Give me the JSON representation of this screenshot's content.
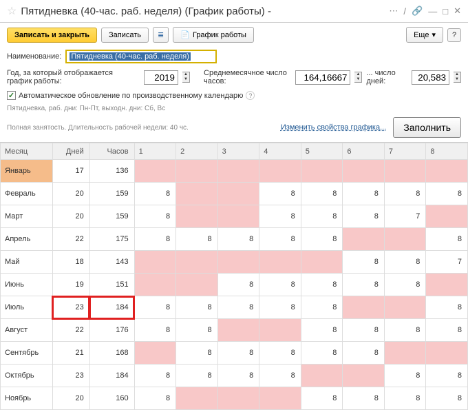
{
  "title": "Пятидневка (40-час. раб. неделя) (График работы) -",
  "toolbar": {
    "save_close": "Записать и закрыть",
    "save": "Записать",
    "schedule": "График работы",
    "more": "Еще"
  },
  "form": {
    "name_label": "Наименование:",
    "name_value": "Пятидневка (40-час. раб. неделя)",
    "year_label": "Год, за который отображается график работы:",
    "year_value": "2019",
    "avg_hours_label": "Среднемесячное число часов:",
    "avg_hours_value": "164,16667",
    "days_label": "... число дней:",
    "days_value": "20,583",
    "auto_update": "Автоматическое обновление по производственному календарю"
  },
  "hints": {
    "line1": "Пятидневка, раб. дни: Пн-Пт, выходн. дни: Сб, Вс",
    "line2": "Полная занятость. Длительность рабочей недели: 40 чс."
  },
  "actions": {
    "change_props": "Изменить свойства графика...",
    "fill": "Заполнить"
  },
  "headers": {
    "month": "Месяц",
    "days": "Дней",
    "hours": "Часов",
    "d1": "1",
    "d2": "2",
    "d3": "3",
    "d4": "4",
    "d5": "5",
    "d6": "6",
    "d7": "7",
    "d8": "8"
  },
  "rows": [
    {
      "month": "Январь",
      "days": 17,
      "hours": 136,
      "cells": [
        {
          "v": "",
          "c": "pink"
        },
        {
          "v": "",
          "c": "pink"
        },
        {
          "v": "",
          "c": "pink"
        },
        {
          "v": "",
          "c": "pink"
        },
        {
          "v": "",
          "c": "pink"
        },
        {
          "v": "",
          "c": "pink"
        },
        {
          "v": "",
          "c": "pink"
        },
        {
          "v": "",
          "c": "pink"
        }
      ],
      "mClass": "orange"
    },
    {
      "month": "Февраль",
      "days": 20,
      "hours": 159,
      "cells": [
        {
          "v": "8",
          "c": ""
        },
        {
          "v": "",
          "c": "pink"
        },
        {
          "v": "",
          "c": "pink"
        },
        {
          "v": "8",
          "c": ""
        },
        {
          "v": "8",
          "c": ""
        },
        {
          "v": "8",
          "c": ""
        },
        {
          "v": "8",
          "c": ""
        },
        {
          "v": "8",
          "c": ""
        }
      ]
    },
    {
      "month": "Март",
      "days": 20,
      "hours": 159,
      "cells": [
        {
          "v": "8",
          "c": ""
        },
        {
          "v": "",
          "c": "pink"
        },
        {
          "v": "",
          "c": "pink"
        },
        {
          "v": "8",
          "c": ""
        },
        {
          "v": "8",
          "c": ""
        },
        {
          "v": "8",
          "c": ""
        },
        {
          "v": "7",
          "c": ""
        },
        {
          "v": "",
          "c": "pink"
        }
      ]
    },
    {
      "month": "Апрель",
      "days": 22,
      "hours": 175,
      "cells": [
        {
          "v": "8",
          "c": ""
        },
        {
          "v": "8",
          "c": ""
        },
        {
          "v": "8",
          "c": ""
        },
        {
          "v": "8",
          "c": ""
        },
        {
          "v": "8",
          "c": ""
        },
        {
          "v": "",
          "c": "pink"
        },
        {
          "v": "",
          "c": "pink"
        },
        {
          "v": "8",
          "c": ""
        }
      ]
    },
    {
      "month": "Май",
      "days": 18,
      "hours": 143,
      "cells": [
        {
          "v": "",
          "c": "pink"
        },
        {
          "v": "",
          "c": "pink"
        },
        {
          "v": "",
          "c": "pink"
        },
        {
          "v": "",
          "c": "pink"
        },
        {
          "v": "",
          "c": "pink"
        },
        {
          "v": "8",
          "c": ""
        },
        {
          "v": "8",
          "c": ""
        },
        {
          "v": "7",
          "c": ""
        }
      ]
    },
    {
      "month": "Июнь",
      "days": 19,
      "hours": 151,
      "cells": [
        {
          "v": "",
          "c": "pink"
        },
        {
          "v": "",
          "c": "pink"
        },
        {
          "v": "8",
          "c": ""
        },
        {
          "v": "8",
          "c": ""
        },
        {
          "v": "8",
          "c": ""
        },
        {
          "v": "8",
          "c": ""
        },
        {
          "v": "8",
          "c": ""
        },
        {
          "v": "",
          "c": "pink"
        }
      ]
    },
    {
      "month": "Июль",
      "days": 23,
      "hours": 184,
      "hl": true,
      "cells": [
        {
          "v": "8",
          "c": ""
        },
        {
          "v": "8",
          "c": ""
        },
        {
          "v": "8",
          "c": ""
        },
        {
          "v": "8",
          "c": ""
        },
        {
          "v": "8",
          "c": ""
        },
        {
          "v": "",
          "c": "pink"
        },
        {
          "v": "",
          "c": "pink"
        },
        {
          "v": "8",
          "c": ""
        }
      ]
    },
    {
      "month": "Август",
      "days": 22,
      "hours": 176,
      "cells": [
        {
          "v": "8",
          "c": ""
        },
        {
          "v": "8",
          "c": ""
        },
        {
          "v": "",
          "c": "pink"
        },
        {
          "v": "",
          "c": "pink"
        },
        {
          "v": "8",
          "c": ""
        },
        {
          "v": "8",
          "c": ""
        },
        {
          "v": "8",
          "c": ""
        },
        {
          "v": "8",
          "c": ""
        }
      ]
    },
    {
      "month": "Сентябрь",
      "days": 21,
      "hours": 168,
      "cells": [
        {
          "v": "",
          "c": "pink"
        },
        {
          "v": "8",
          "c": ""
        },
        {
          "v": "8",
          "c": ""
        },
        {
          "v": "8",
          "c": ""
        },
        {
          "v": "8",
          "c": ""
        },
        {
          "v": "8",
          "c": ""
        },
        {
          "v": "",
          "c": "pink"
        },
        {
          "v": "",
          "c": "pink"
        }
      ]
    },
    {
      "month": "Октябрь",
      "days": 23,
      "hours": 184,
      "cells": [
        {
          "v": "8",
          "c": ""
        },
        {
          "v": "8",
          "c": ""
        },
        {
          "v": "8",
          "c": ""
        },
        {
          "v": "8",
          "c": ""
        },
        {
          "v": "",
          "c": "pink"
        },
        {
          "v": "",
          "c": "pink"
        },
        {
          "v": "8",
          "c": ""
        },
        {
          "v": "8",
          "c": ""
        }
      ]
    },
    {
      "month": "Ноябрь",
      "days": 20,
      "hours": 160,
      "cells": [
        {
          "v": "8",
          "c": ""
        },
        {
          "v": "",
          "c": "pink"
        },
        {
          "v": "",
          "c": "pink"
        },
        {
          "v": "",
          "c": "pink"
        },
        {
          "v": "8",
          "c": ""
        },
        {
          "v": "8",
          "c": ""
        },
        {
          "v": "8",
          "c": ""
        },
        {
          "v": "8",
          "c": ""
        }
      ]
    }
  ]
}
